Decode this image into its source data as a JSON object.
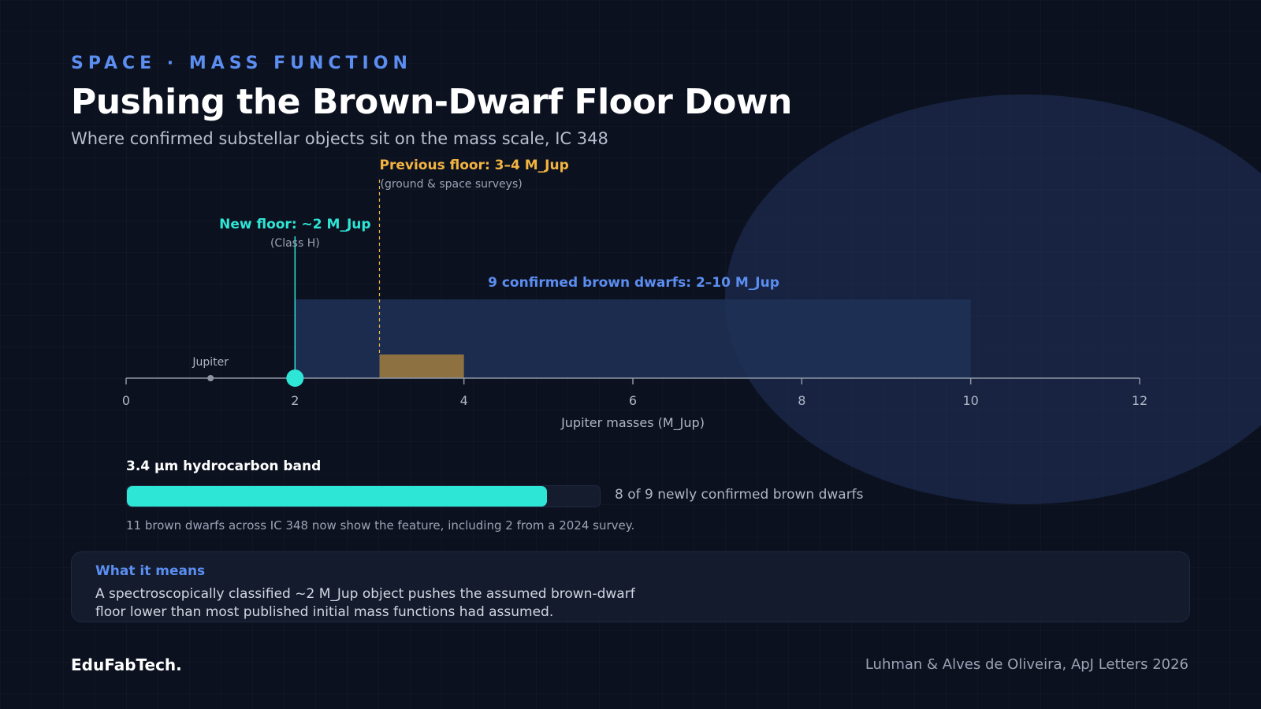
{
  "header": {
    "eyebrow": "SPACE · MASS FUNCTION",
    "title": "Pushing the Brown-Dwarf Floor Down",
    "subtitle": "Where confirmed substellar objects sit on the mass scale, IC 348"
  },
  "chart_data": {
    "type": "number-line",
    "xlabel": "Jupiter masses (M_Jup)",
    "xlim": [
      0,
      12
    ],
    "ticks": [
      0,
      2,
      4,
      6,
      8,
      10,
      12
    ],
    "ranges": [
      {
        "label": "9 confirmed brown dwarfs: 2–10 M_Jup",
        "start": 2,
        "end": 10,
        "color": "#1e3157"
      },
      {
        "label": "Previous floor: 3–4 M_Jup",
        "note": "(ground & space surveys)",
        "start": 3,
        "end": 4,
        "color": "#8d7140",
        "label_color": "#f3b440"
      }
    ],
    "markers": [
      {
        "label": "New floor: ~2 M_Jup",
        "note": "(Class H)",
        "x": 2,
        "color": "#2ee6d6"
      },
      {
        "label": "Jupiter",
        "x": 1,
        "color": "#8e96a6"
      }
    ]
  },
  "band": {
    "title": "3.4 µm hydrocarbon band",
    "value": 8,
    "total": 9,
    "value_text": "8 of 9 newly confirmed brown dwarfs",
    "note": "11 brown dwarfs across IC 348 now show the feature, including 2 from a 2024 survey.",
    "color": "#2ee6d6"
  },
  "callout": {
    "heading": "What it means",
    "body": "A spectroscopically classified ~2 M_Jup object pushes the assumed brown-dwarf floor lower than most published initial mass functions had assumed."
  },
  "footer": {
    "brand": "EduFabTech.",
    "citation": "Luhman & Alves de Oliveira, ApJ Letters 2026"
  },
  "colors": {
    "accent_blue": "#5b8ef0",
    "accent_teal": "#2ee6d6",
    "accent_gold": "#f3b440",
    "background": "#0c1120"
  }
}
